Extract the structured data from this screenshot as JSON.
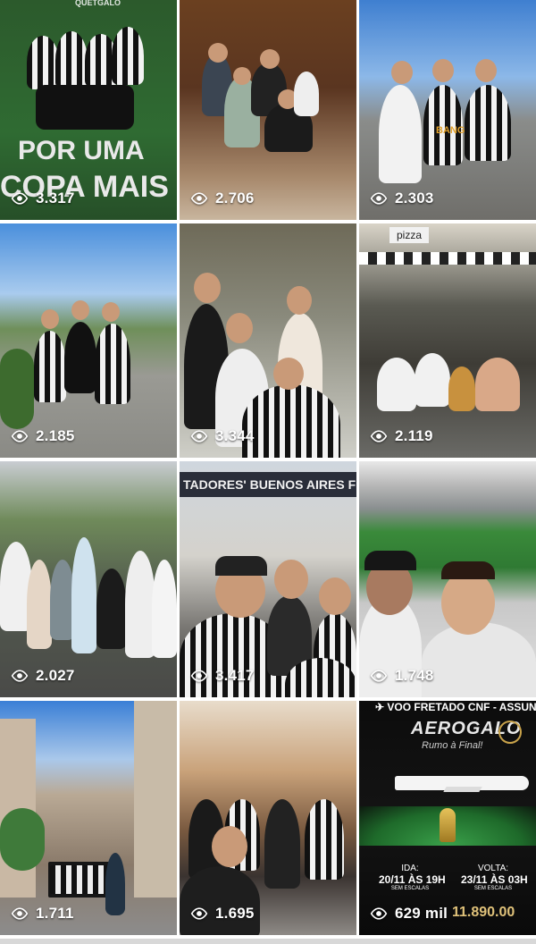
{
  "grid": {
    "tiles": [
      {
        "views": "3.317",
        "small_top": "QUETGALO",
        "headline_line1": "POR UMA",
        "headline_line2": "COPA MAIS"
      },
      {
        "views": "2.706"
      },
      {
        "views": "2.303",
        "shirt_text": "BANG"
      },
      {
        "views": "2.185"
      },
      {
        "views": "3.344"
      },
      {
        "views": "2.119",
        "sign": "pizza"
      },
      {
        "views": "2.027"
      },
      {
        "views": "3.417",
        "banner": "TADORES' BUENOS AIRES FINA"
      },
      {
        "views": "1.748"
      },
      {
        "views": "1.711"
      },
      {
        "views": "1.695"
      },
      {
        "views": "629 mil",
        "poster": {
          "top": "VOO FRETADO CNF - ASSUNÇÃO",
          "brand": "AEROGALO",
          "tagline": "Rumo à Final!",
          "ida_label": "IDA:",
          "ida_date": "20/11 ÀS 19H",
          "ida_note": "SEM ESCALAS",
          "volta_label": "VOLTA:",
          "volta_date": "23/11 ÀS 03H",
          "volta_note": "SEM ESCALAS",
          "price": "11.890.00"
        }
      }
    ]
  },
  "icons": {
    "views": "eye-icon"
  },
  "colors": {
    "sky": "#4a90d9",
    "grass": "#3a8a3a",
    "overlay_text": "#ffffff"
  }
}
